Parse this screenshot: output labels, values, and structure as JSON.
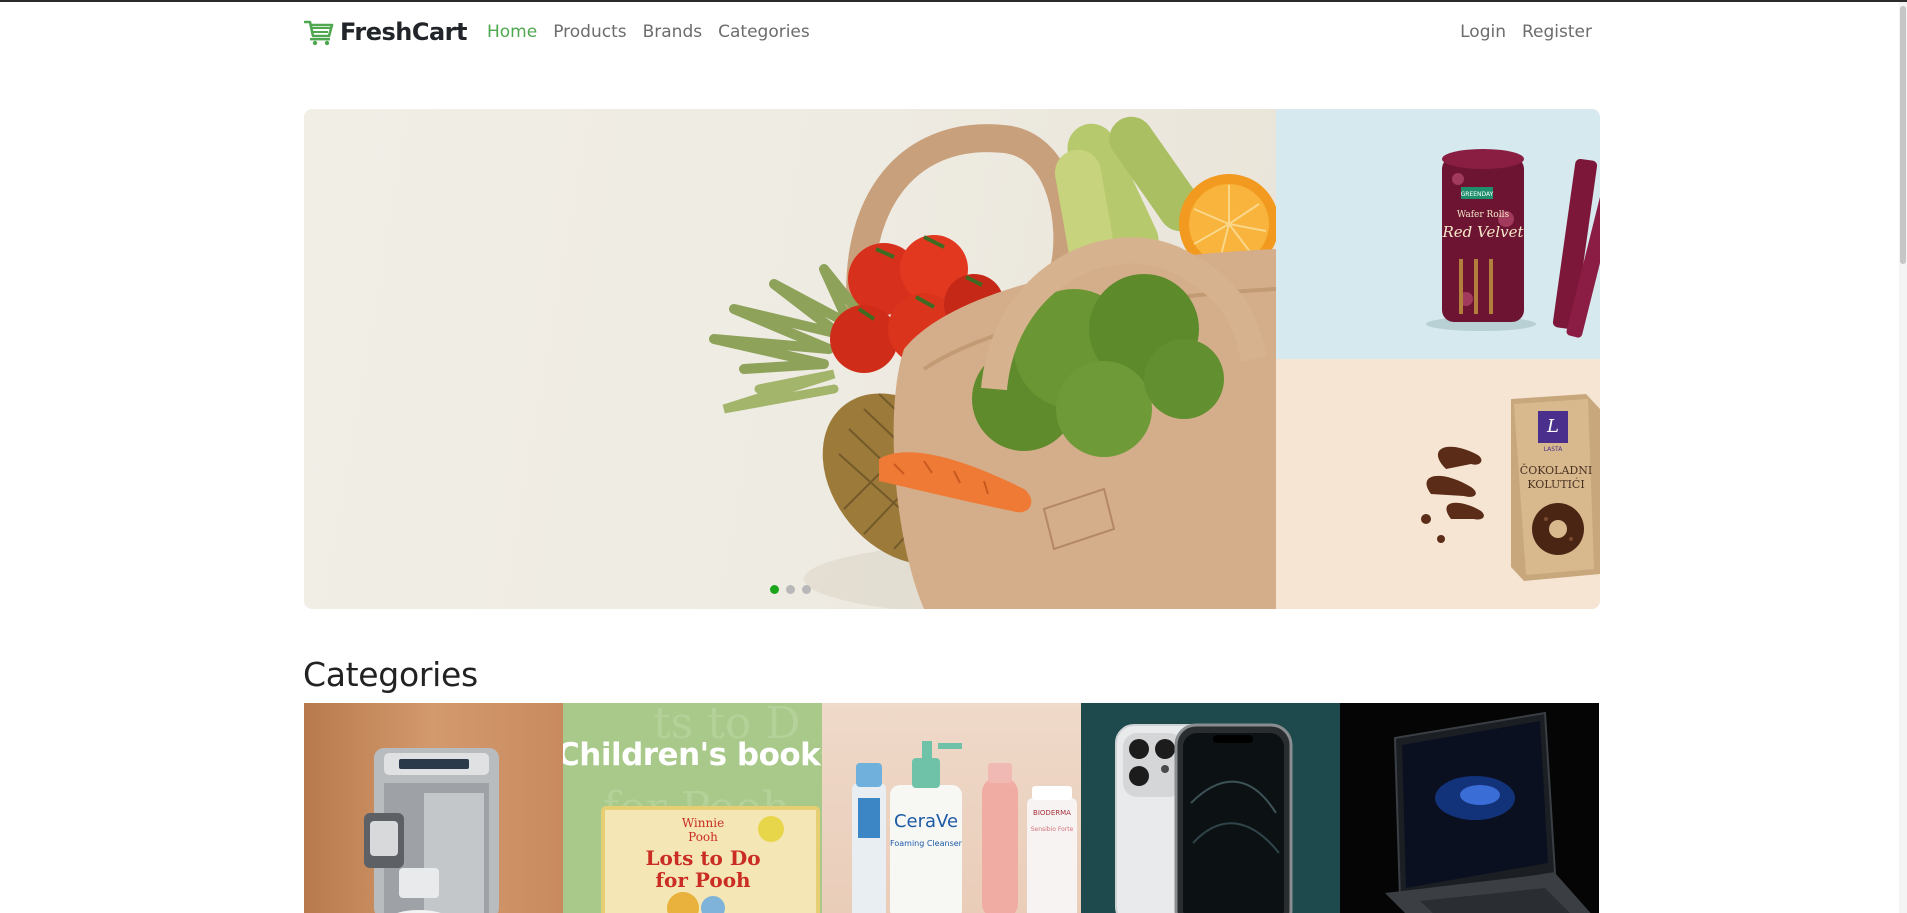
{
  "brand": {
    "name": "FreshCart",
    "color": "#4fa74f"
  },
  "nav": {
    "left": [
      {
        "label": "Home",
        "active": true
      },
      {
        "label": "Products",
        "active": false
      },
      {
        "label": "Brands",
        "active": false
      },
      {
        "label": "Categories",
        "active": false
      }
    ],
    "right": [
      {
        "label": "Login"
      },
      {
        "label": "Register"
      }
    ]
  },
  "hero": {
    "slides_count": 3,
    "active_slide": 1,
    "side_top_pack": {
      "brand_tag": "GREENDAY",
      "line1": "Wafer Rolls",
      "line2": "Red Velvet"
    },
    "side_bottom_pack": {
      "line1": "LASTA",
      "line2": "ČOKOLADNI",
      "line3": "KOLUTIĆI"
    }
  },
  "categories": {
    "title": "Categories",
    "cards_visible": 5,
    "books_banner": "Children's books",
    "book_cover": {
      "line1": "Winnie",
      "line2": "Pooh",
      "title_line1": "Lots to Do",
      "title_line2": "for Pooh"
    },
    "cerave": {
      "brand": "CeraVe",
      "product": "Foaming Cleanser"
    },
    "bioderma": {
      "brand": "BIODERMA",
      "product": "Sensibio Forte"
    }
  },
  "colors": {
    "accent": "#4fa74f",
    "active_dot": "#1aa51a",
    "nav_text": "#6c6c6c"
  }
}
